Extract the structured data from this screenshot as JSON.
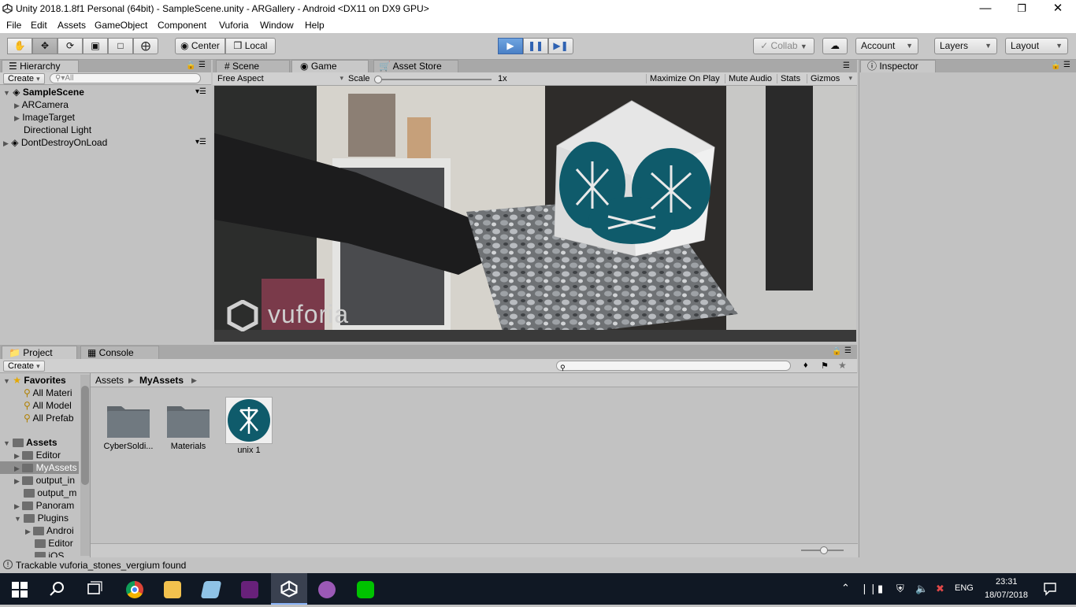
{
  "window": {
    "title": "Unity 2018.1.8f1 Personal (64bit) - SampleScene.unity - ARGallery - Android <DX11 on DX9 GPU>"
  },
  "menu": [
    "File",
    "Edit",
    "Assets",
    "GameObject",
    "Component",
    "Vuforia",
    "Window",
    "Help"
  ],
  "toolbar": {
    "pivot": "Center",
    "space": "Local",
    "collab": "Collab",
    "account": "Account",
    "layers": "Layers",
    "layout": "Layout"
  },
  "hierarchy": {
    "tab": "Hierarchy",
    "create": "Create",
    "search_placeholder": "All",
    "scene": "SampleScene",
    "items": [
      "ARCamera",
      "ImageTarget",
      "Directional Light"
    ],
    "dontdestroy": "DontDestroyOnLoad"
  },
  "center_tabs": {
    "scene": "Scene",
    "game": "Game",
    "asset_store": "Asset Store"
  },
  "game": {
    "aspect": "Free Aspect",
    "scale_label": "Scale",
    "scale_value": "1x",
    "maximize": "Maximize On Play",
    "mute": "Mute Audio",
    "stats": "Stats",
    "gizmos": "Gizmos",
    "watermark": "vuforia"
  },
  "inspector": {
    "tab": "Inspector"
  },
  "project": {
    "tab": "Project",
    "console_tab": "Console",
    "create": "Create",
    "favorites_label": "Favorites",
    "favorites": [
      "All Materi",
      "All Model",
      "All Prefab"
    ],
    "assets_label": "Assets",
    "tree": [
      "Editor",
      "MyAssets",
      "output_in",
      "output_m",
      "Panoram",
      "Plugins",
      "Androi",
      "Editor",
      "iOS"
    ],
    "breadcrumb": [
      "Assets",
      "MyAssets"
    ],
    "files": [
      "CyberSoldi...",
      "Materials",
      "unix 1"
    ]
  },
  "status": {
    "message": "Trackable vuforia_stones_vergium found"
  },
  "taskbar": {
    "language": "ENG",
    "time": "23:31",
    "date": "18/07/2018"
  },
  "colors": {
    "accent": "#3d78c7",
    "teal": "#0f5b6b",
    "taskbar": "#101824"
  }
}
